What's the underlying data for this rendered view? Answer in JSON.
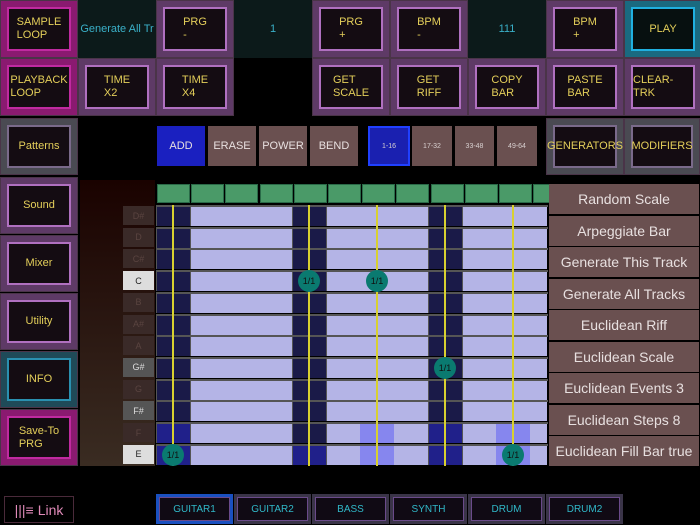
{
  "top_row1": [
    "SAMPLE\nLOOP",
    "Generate All Tr",
    "PRG\n-",
    "1",
    "PRG\n+",
    "BPM\n-",
    "111",
    "BPM\n+",
    "PLAY"
  ],
  "top_row2": [
    "PLAYBACK\nLOOP",
    "TIME\nX2",
    "TIME\nX4",
    "GET\nSCALE",
    "GET\nRIFF",
    "COPY\nBAR",
    "PASTE\nBAR",
    "CLEAR-TRK"
  ],
  "left": [
    "Patterns",
    "Sound",
    "Mixer",
    "Utility",
    "INFO",
    "Save-To\nPRG"
  ],
  "tools": [
    "ADD",
    "ERASE",
    "POWER",
    "BEND"
  ],
  "selected_tool": "ADD",
  "pages": [
    "1-16",
    "17-32",
    "33-48",
    "49-64"
  ],
  "selected_page": "1-16",
  "panels": [
    "GENERATORS",
    "MODIFIERS"
  ],
  "notes": [
    "D#",
    "D",
    "C#",
    "C",
    "B",
    "A#",
    "A",
    "G#",
    "G",
    "F#",
    "F",
    "E"
  ],
  "note_events": [
    {
      "note": "E",
      "step": 0,
      "label": "1/1"
    },
    {
      "note": "C",
      "step": 4,
      "label": "1/1"
    },
    {
      "note": "C",
      "step": 6,
      "label": "1/1"
    },
    {
      "note": "G#",
      "step": 8,
      "label": "1/1"
    },
    {
      "note": "E",
      "step": 10,
      "label": "1/1"
    }
  ],
  "generators": [
    "Random Scale",
    "Arpeggiate Bar",
    "Generate This Track",
    "Generate All Tracks",
    "Euclidean Riff",
    "Euclidean Scale",
    "Euclidean Events 3",
    "Euclidean Steps 8",
    "Euclidean Fill Bar true"
  ],
  "link_label": "Link",
  "tracks": [
    "GUITAR1",
    "GUITAR2",
    "BASS",
    "SYNTH",
    "DRUM",
    "DRUM2"
  ],
  "selected_track": "GUITAR1"
}
